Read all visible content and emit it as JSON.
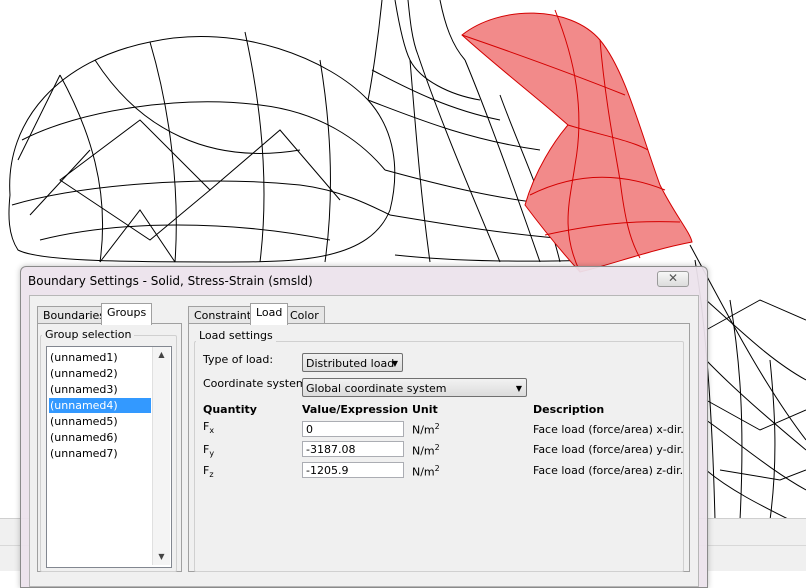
{
  "dialog": {
    "title": "Boundary Settings - Solid, Stress-Strain (smsld)",
    "close_glyph": "✕"
  },
  "left_tabs": [
    "Boundaries",
    "Groups"
  ],
  "left_active_tab": "Groups",
  "group_selection": {
    "label": "Group selection",
    "items": [
      "(unnamed1)",
      "(unnamed2)",
      "(unnamed3)",
      "(unnamed4)",
      "(unnamed5)",
      "(unnamed6)",
      "(unnamed7)"
    ],
    "selected": "(unnamed4)"
  },
  "right_tabs": [
    "Constraint",
    "Load",
    "Color"
  ],
  "right_active_tab": "Load",
  "load_settings": {
    "label": "Load settings",
    "type_of_load_label": "Type of load:",
    "type_of_load_value": "Distributed load",
    "coord_system_label": "Coordinate system:",
    "coord_system_value": "Global coordinate system",
    "columns": {
      "quantity": "Quantity",
      "value": "Value/Expression",
      "unit": "Unit",
      "description": "Description"
    },
    "rows": [
      {
        "sym": "F",
        "sub": "x",
        "value": "0",
        "unit": "N/m",
        "unit_sup": "2",
        "description": "Face load (force/area) x-dir."
      },
      {
        "sym": "F",
        "sub": "y",
        "value": "-3187.08",
        "unit": "N/m",
        "unit_sup": "2",
        "description": "Face load (force/area) y-dir."
      },
      {
        "sym": "F",
        "sub": "z",
        "value": "-1205.9",
        "unit": "N/m",
        "unit_sup": "2",
        "description": "Face load (force/area) z-dir."
      }
    ]
  },
  "colors": {
    "highlight_face": "#f28a8a",
    "highlight_edge": "#d40000",
    "selection": "#3399ff"
  }
}
